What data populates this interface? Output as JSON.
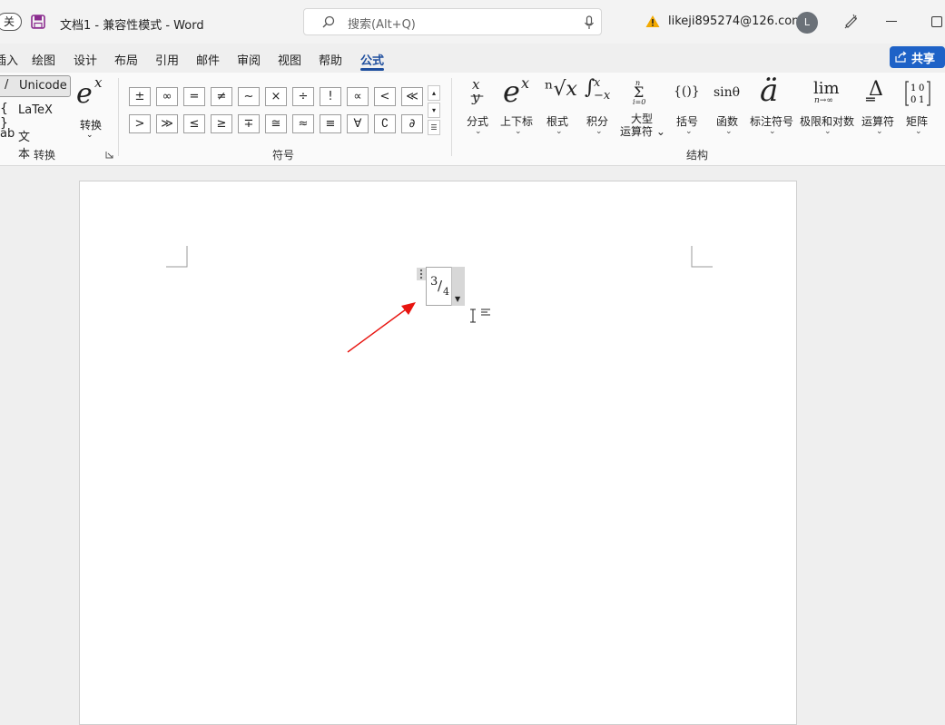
{
  "titlebar": {
    "autosave_label": "关",
    "doc_title": "文档1  -  兼容性模式  -  Word",
    "search_placeholder": "搜索(Alt+Q)",
    "account": "likeji895274@126.com",
    "avatar_initial": "L"
  },
  "tabs": [
    "插入",
    "绘图",
    "设计",
    "布局",
    "引用",
    "邮件",
    "审阅",
    "视图",
    "帮助",
    "公式"
  ],
  "active_tab": "公式",
  "share_label": "共享",
  "convert_group": {
    "unicode": "Unicode",
    "unicode_icon": "/",
    "latex": "LaTeX",
    "latex_icon": "{ }",
    "text": "文本",
    "text_icon": "ab",
    "convert_label": "转换",
    "group_label": "转换"
  },
  "symbols_group": {
    "row1": [
      "±",
      "∞",
      "=",
      "≠",
      "~",
      "×",
      "÷",
      "!",
      "∝",
      "<",
      "≪"
    ],
    "row2": [
      ">",
      "≫",
      "≤",
      "≥",
      "∓",
      "≅",
      "≈",
      "≡",
      "∀",
      "∁",
      "∂"
    ],
    "group_label": "符号"
  },
  "structures_group": {
    "items": [
      {
        "label": "分式",
        "glyph": "x/y"
      },
      {
        "label": "上下标",
        "glyph": "eˣ"
      },
      {
        "label": "根式",
        "glyph": "ⁿ√x"
      },
      {
        "label": "积分",
        "glyph": "∫x −x"
      },
      {
        "label": "大型\n运算符",
        "glyph": "Σ"
      },
      {
        "label": "括号",
        "glyph": "{()}"
      },
      {
        "label": "函数",
        "glyph": "sinθ"
      },
      {
        "label": "标注符号",
        "glyph": "ä"
      },
      {
        "label": "极限和对数",
        "glyph": "lim n→∞"
      },
      {
        "label": "运算符",
        "glyph": "Δ"
      },
      {
        "label": "矩阵",
        "glyph": "[10;01]"
      }
    ],
    "group_label": "结构"
  },
  "equation": {
    "numerator": "3",
    "slash": "/",
    "denominator": "4"
  },
  "colors": {
    "accent": "#1e4e9e",
    "share": "#1e62c7",
    "arrow": "#e8140f"
  }
}
